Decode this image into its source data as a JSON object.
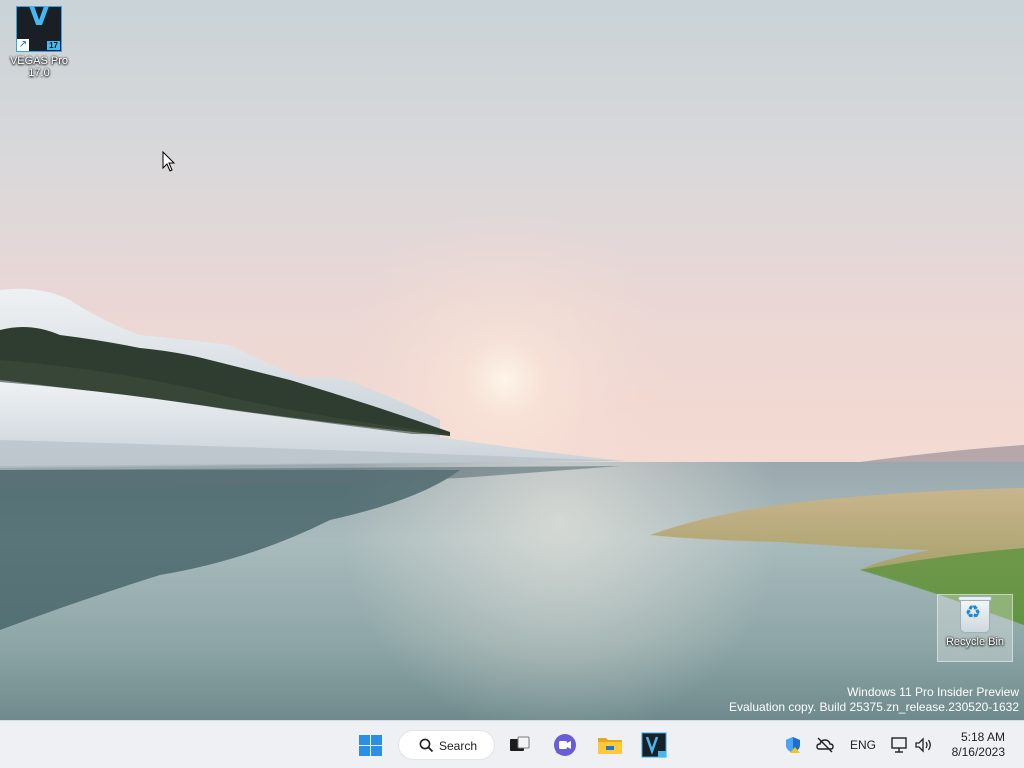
{
  "desktop": {
    "icons": [
      {
        "label": "VEGAS Pro 17.0",
        "icon": "vegas-pro-icon",
        "badge": "17",
        "glyph": "V"
      },
      {
        "label": "Recycle Bin",
        "icon": "recycle-bin-icon"
      }
    ],
    "watermark": {
      "line1": "Windows 11 Pro Insider Preview",
      "line2": "Evaluation copy. Build 25375.zn_release.230520-1632"
    }
  },
  "taskbar": {
    "search_label": "Search",
    "pinned": [
      {
        "name": "start",
        "icon": "windows-logo-icon"
      },
      {
        "name": "task-view",
        "icon": "task-view-icon"
      },
      {
        "name": "chat",
        "icon": "chat-icon"
      },
      {
        "name": "file-explorer",
        "icon": "folder-icon"
      },
      {
        "name": "vegas-pro",
        "icon": "vegas-pro-icon",
        "badge": "17"
      }
    ],
    "tray": {
      "language": "ENG",
      "time": "5:18 AM",
      "date": "8/16/2023",
      "icons": [
        "security-shield-icon",
        "network-offline-icon",
        "display-icon",
        "volume-icon"
      ]
    }
  },
  "colors": {
    "accent": "#2a8fe5",
    "taskbar_bg": "#eef0f3"
  }
}
